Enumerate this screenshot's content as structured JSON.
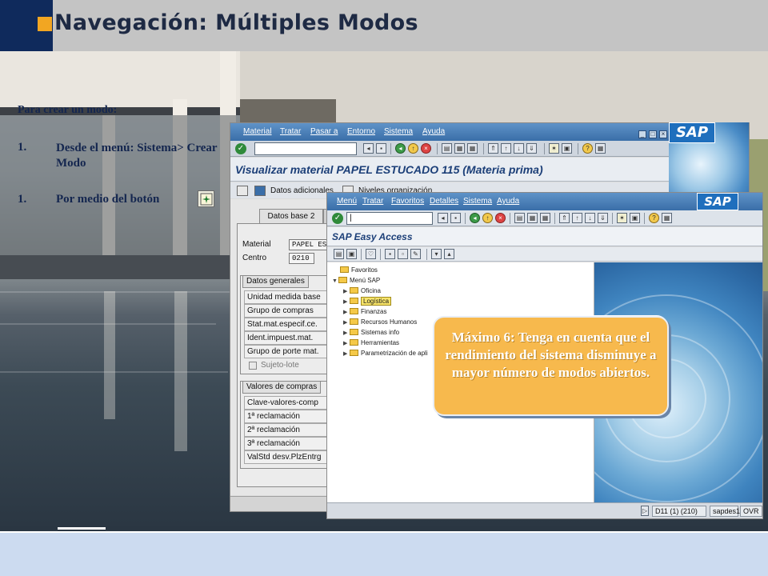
{
  "slide": {
    "title": "Navegación: Múltiples Modos"
  },
  "instructions": {
    "intro": "Para crear un modo:",
    "steps": [
      {
        "number": "1.",
        "text": "Desde el menú: Sistema> Crear Modo"
      },
      {
        "number": "1.",
        "text": "Por medio del botón"
      }
    ],
    "button_icon": "create-session-icon"
  },
  "window_material": {
    "menu": [
      "Material",
      "Tratar",
      "Pasar a",
      "Entorno",
      "Sistema",
      "Ayuda"
    ],
    "title": "Visualizar material PAPEL ESTUCADO 115 (Materia prima)",
    "app_toolbar": [
      "Datos adicionales",
      "Niveles organización"
    ],
    "tab": "Datos base 2",
    "fields": {
      "material_label": "Material",
      "material_value": "PAPEL ES",
      "centro_label": "Centro",
      "centro_value": "0210"
    },
    "datos_generales": {
      "title": "Datos generales",
      "rows": [
        "Unidad medida base",
        "Grupo de compras",
        "Stat.mat.especif.ce.",
        "Ident.impuest.mat.",
        "Grupo de porte mat."
      ],
      "checkbox_label": "Sujeto-lote"
    },
    "valores_compras": {
      "title": "Valores de compras",
      "rows": [
        "Clave-valores-comp",
        "1ª reclamación",
        "2ª reclamación",
        "3ª reclamación",
        "ValStd desv.PlzEntrg"
      ]
    },
    "logo": "SAP"
  },
  "window_easy_access": {
    "menu": [
      "Menú",
      "Tratar",
      "Favoritos",
      "Detalles",
      "Sistema",
      "Ayuda"
    ],
    "command_value": "|",
    "title": "SAP Easy Access",
    "tree": {
      "favoritos": "Favoritos",
      "menu_sap": "Menú SAP",
      "items": [
        "Oficina",
        "Logística",
        "Finanzas",
        "Recursos Humanos",
        "Sistemas info",
        "Herramientas",
        "Parametrización de apli"
      ]
    },
    "status": {
      "system": "D11 (1) (210)",
      "server": "sapdes1",
      "mode": "OVR"
    },
    "logo": "SAP"
  },
  "callout": {
    "text": "Máximo 6: Tenga en cuenta que el rendimiento del sistema disminuye a mayor número de modos abiertos."
  },
  "colors": {
    "header_gray": "#c4c4c4",
    "header_navy": "#0f2a5c",
    "accent_orange": "#f2a622",
    "text_navy": "#14264f",
    "sap_blue": "#1f6fbd",
    "callout_orange": "#f7b94d",
    "bottom_band": "#ccdbf0"
  }
}
